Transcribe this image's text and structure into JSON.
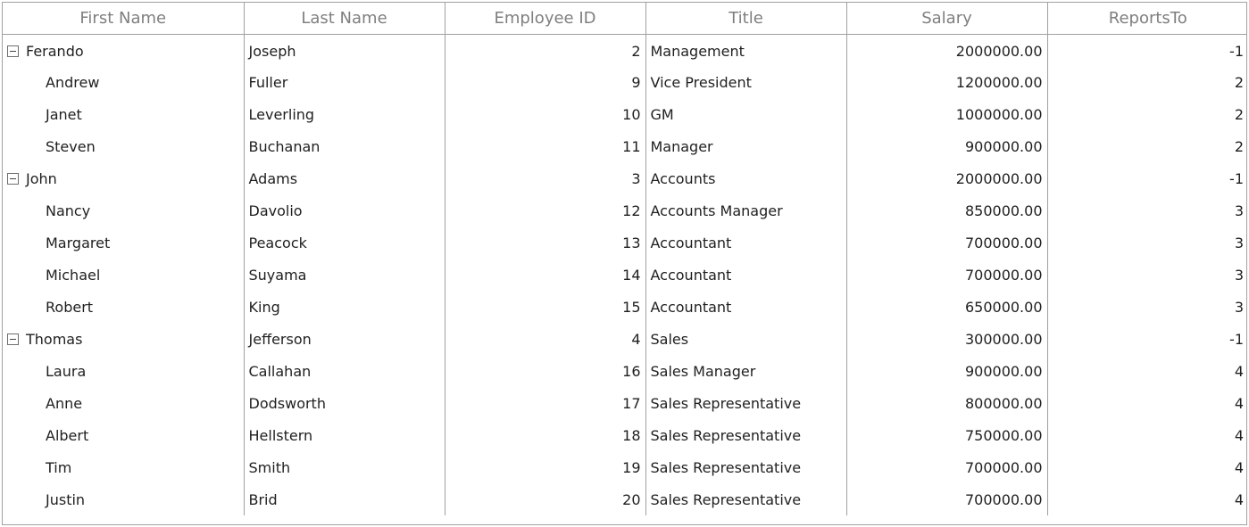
{
  "columns": [
    "First Name",
    "Last Name",
    "Employee ID",
    "Title",
    "Salary",
    "ReportsTo"
  ],
  "rows": [
    {
      "first": "Ferando",
      "last": "Joseph",
      "id": "2",
      "title": "Management",
      "salary": "2000000.00",
      "reports": "-1",
      "parent": true
    },
    {
      "first": "Andrew",
      "last": "Fuller",
      "id": "9",
      "title": "Vice President",
      "salary": "1200000.00",
      "reports": "2",
      "parent": false
    },
    {
      "first": "Janet",
      "last": "Leverling",
      "id": "10",
      "title": "GM",
      "salary": "1000000.00",
      "reports": "2",
      "parent": false
    },
    {
      "first": "Steven",
      "last": "Buchanan",
      "id": "11",
      "title": "Manager",
      "salary": "900000.00",
      "reports": "2",
      "parent": false
    },
    {
      "first": "John",
      "last": "Adams",
      "id": "3",
      "title": "Accounts",
      "salary": "2000000.00",
      "reports": "-1",
      "parent": true
    },
    {
      "first": "Nancy",
      "last": "Davolio",
      "id": "12",
      "title": "Accounts Manager",
      "salary": "850000.00",
      "reports": "3",
      "parent": false
    },
    {
      "first": "Margaret",
      "last": "Peacock",
      "id": "13",
      "title": "Accountant",
      "salary": "700000.00",
      "reports": "3",
      "parent": false
    },
    {
      "first": "Michael",
      "last": "Suyama",
      "id": "14",
      "title": "Accountant",
      "salary": "700000.00",
      "reports": "3",
      "parent": false
    },
    {
      "first": "Robert",
      "last": "King",
      "id": "15",
      "title": "Accountant",
      "salary": "650000.00",
      "reports": "3",
      "parent": false
    },
    {
      "first": "Thomas",
      "last": "Jefferson",
      "id": "4",
      "title": "Sales",
      "salary": "300000.00",
      "reports": "-1",
      "parent": true
    },
    {
      "first": "Laura",
      "last": "Callahan",
      "id": "16",
      "title": "Sales Manager",
      "salary": "900000.00",
      "reports": "4",
      "parent": false
    },
    {
      "first": "Anne",
      "last": "Dodsworth",
      "id": "17",
      "title": "Sales Representative",
      "salary": "800000.00",
      "reports": "4",
      "parent": false
    },
    {
      "first": "Albert",
      "last": "Hellstern",
      "id": "18",
      "title": "Sales Representative",
      "salary": "750000.00",
      "reports": "4",
      "parent": false
    },
    {
      "first": "Tim",
      "last": "Smith",
      "id": "19",
      "title": "Sales Representative",
      "salary": "700000.00",
      "reports": "4",
      "parent": false
    },
    {
      "first": "Justin",
      "last": "Brid",
      "id": "20",
      "title": "Sales Representative",
      "salary": "700000.00",
      "reports": "4",
      "parent": false
    }
  ],
  "icons": {
    "expanded": "collapse-minus-icon"
  }
}
